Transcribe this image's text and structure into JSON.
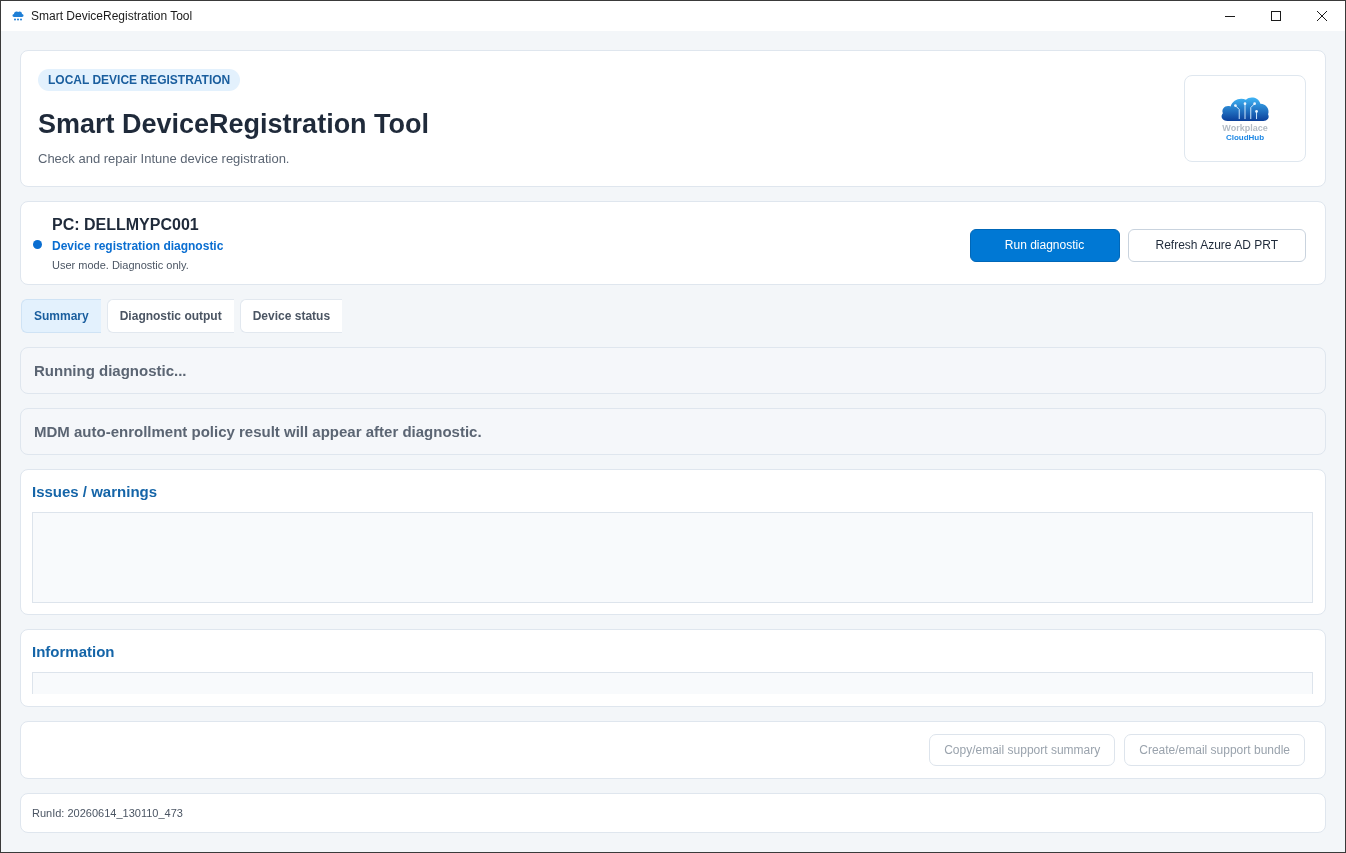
{
  "window": {
    "title": "Smart DeviceRegistration Tool"
  },
  "header": {
    "badge": "LOCAL DEVICE REGISTRATION",
    "title": "Smart DeviceRegistration Tool",
    "subtitle": "Check and repair Intune device registration.",
    "logo": {
      "line_1": "Workplace",
      "line_2": "CloudHub"
    }
  },
  "device": {
    "name": "PC: DELLMYPC001",
    "mode": "Device registration diagnostic",
    "note": "User mode. Diagnostic only.",
    "buttons": [
      {
        "label": "Run diagnostic",
        "kind": "primary"
      },
      {
        "label": "Refresh Azure AD PRT",
        "kind": "secondary"
      }
    ]
  },
  "tabs": [
    {
      "label": "Summary",
      "selected": true
    },
    {
      "label": "Diagnostic output",
      "selected": false
    },
    {
      "label": "Device status",
      "selected": false
    }
  ],
  "status_messages": [
    "Running diagnostic...",
    "MDM auto-enrollment policy result will appear after diagnostic."
  ],
  "issues": {
    "title": "Issues / warnings"
  },
  "information": {
    "title": "Information"
  },
  "actions": [
    {
      "label": "Copy/email support summary",
      "disabled": true
    },
    {
      "label": "Create/email support bundle",
      "disabled": true
    }
  ],
  "footer": {
    "run_id": "RunId: 20260614_130110_473"
  }
}
